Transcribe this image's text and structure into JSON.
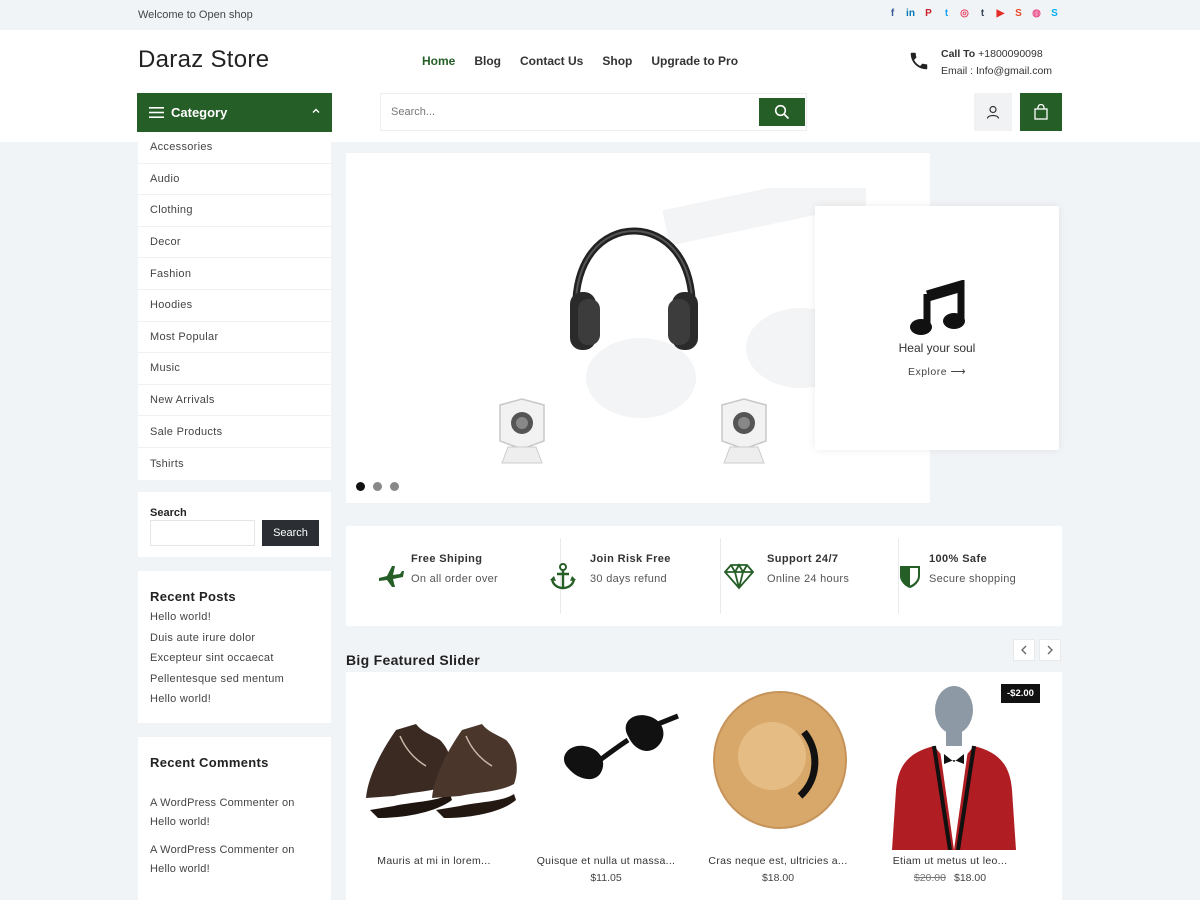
{
  "topbar": {
    "welcome": "Welcome to Open shop",
    "social": [
      {
        "icon": "facebook-icon",
        "glyph": "f",
        "color": "#3b5998"
      },
      {
        "icon": "linkedin-icon",
        "glyph": "in",
        "color": "#0077b5"
      },
      {
        "icon": "pinterest-icon",
        "glyph": "P",
        "color": "#cb2027"
      },
      {
        "icon": "twitter-icon",
        "glyph": "t",
        "color": "#1da1f2"
      },
      {
        "icon": "instagram-icon",
        "glyph": "◎",
        "color": "#e4405f"
      },
      {
        "icon": "tumblr-icon",
        "glyph": "t",
        "color": "#35465c"
      },
      {
        "icon": "youtube-icon",
        "glyph": "▶",
        "color": "#e52d27"
      },
      {
        "icon": "stumbleupon-icon",
        "glyph": "S",
        "color": "#eb4924"
      },
      {
        "icon": "dribbble-icon",
        "glyph": "◍",
        "color": "#ea4c89"
      },
      {
        "icon": "skype-icon",
        "glyph": "S",
        "color": "#00aff0"
      }
    ]
  },
  "header": {
    "logo": "Daraz Store",
    "nav": [
      "Home",
      "Blog",
      "Contact Us",
      "Shop",
      "Upgrade to Pro"
    ],
    "call_label": "Call To",
    "call_number": "+1800090098",
    "email": "Email : Info@gmail.com",
    "category_label": "Category",
    "search_placeholder": "Search..."
  },
  "categories": [
    "Accessories",
    "Audio",
    "Clothing",
    "Decor",
    "Fashion",
    "Hoodies",
    "Most Popular",
    "Music",
    "New Arrivals",
    "Sale Products",
    "Tshirts"
  ],
  "search_widget": {
    "label": "Search",
    "button": "Search"
  },
  "recent_posts": {
    "title": "Recent Posts",
    "items": [
      "Hello world!",
      "Duis aute irure dolor",
      "Excepteur sint occaecat",
      "Pellentesque sed mentum",
      "Hello world!"
    ]
  },
  "recent_comments": {
    "title": "Recent Comments",
    "items": [
      {
        "author": "A WordPress Commenter",
        "on": "on",
        "post": "Hello world!"
      },
      {
        "author": "A WordPress Commenter",
        "on": "on",
        "post": "Hello world!"
      }
    ]
  },
  "hero": {
    "tagline": "Heal your soul",
    "explore": "Explore",
    "slides": 3,
    "active_slide": 1
  },
  "features": [
    {
      "icon": "airplane-icon",
      "title": "Free Shiping",
      "subtitle": "On all order over"
    },
    {
      "icon": "anchor-icon",
      "title": "Join Risk Free",
      "subtitle": "30 days refund"
    },
    {
      "icon": "diamond-icon",
      "title": "Support 24/7",
      "subtitle": "Online 24 hours"
    },
    {
      "icon": "shield-icon",
      "title": "100% Safe",
      "subtitle": "Secure shopping"
    }
  ],
  "featured": {
    "title": "Big Featured Slider",
    "products": [
      {
        "name": "Mauris at mi in lorem...",
        "price": "",
        "old_price": ""
      },
      {
        "name": "Quisque et nulla ut massa...",
        "price": "$11.05",
        "old_price": ""
      },
      {
        "name": "Cras neque est, ultricies a...",
        "price": "$18.00",
        "old_price": ""
      },
      {
        "name": "Etiam ut metus ut leo...",
        "price": "$18.00",
        "old_price": "$20.00"
      }
    ],
    "sale_badge": "-$2.00"
  },
  "colors": {
    "brand": "#265e27",
    "dark": "#2b2f33",
    "background": "#f1f4f7"
  }
}
